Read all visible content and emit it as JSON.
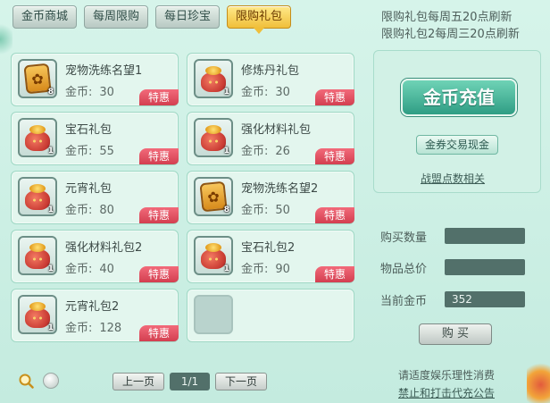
{
  "tabs": [
    {
      "label": "金币商城",
      "active": false
    },
    {
      "label": "每周限购",
      "active": false
    },
    {
      "label": "每日珍宝",
      "active": false
    },
    {
      "label": "限购礼包",
      "active": true
    }
  ],
  "items": [
    {
      "name": "宠物洗练名望1",
      "price_label": "金币:",
      "price": "30",
      "count": "8",
      "icon": "paw-card-icon",
      "badge": "特惠"
    },
    {
      "name": "修炼丹礼包",
      "price_label": "金币:",
      "price": "30",
      "count": "1",
      "icon": "gift-bag-icon",
      "badge": "特惠"
    },
    {
      "name": "宝石礼包",
      "price_label": "金币:",
      "price": "55",
      "count": "1",
      "icon": "gift-bag-icon",
      "badge": "特惠"
    },
    {
      "name": "强化材料礼包",
      "price_label": "金币:",
      "price": "26",
      "count": "1",
      "icon": "gift-bag-icon",
      "badge": "特惠"
    },
    {
      "name": "元宵礼包",
      "price_label": "金币:",
      "price": "80",
      "count": "1",
      "icon": "gift-bag-icon",
      "badge": "特惠"
    },
    {
      "name": "宠物洗练名望2",
      "price_label": "金币:",
      "price": "50",
      "count": "8",
      "icon": "paw-card-icon",
      "badge": "特惠"
    },
    {
      "name": "强化材料礼包2",
      "price_label": "金币:",
      "price": "40",
      "count": "1",
      "icon": "gift-bag-icon",
      "badge": "特惠"
    },
    {
      "name": "宝石礼包2",
      "price_label": "金币:",
      "price": "90",
      "count": "1",
      "icon": "gift-bag-icon",
      "badge": "特惠"
    },
    {
      "name": "元宵礼包2",
      "price_label": "金币:",
      "price": "128",
      "count": "1",
      "icon": "gift-bag-icon",
      "badge": "特惠"
    }
  ],
  "pager": {
    "prev": "上一页",
    "page": "1/1",
    "next": "下一页"
  },
  "notice": {
    "line1": "限购礼包每周五20点刷新",
    "line2": "限购礼包2每周三20点刷新"
  },
  "recharge": {
    "label": "金币充值",
    "coupon": "金券交易现金",
    "alliance": "战盟点数相关"
  },
  "form": {
    "qty_label": "购买数量",
    "qty_value": "",
    "total_label": "物品总价",
    "total_value": "",
    "coins_label": "当前金币",
    "coins_value": "352",
    "buy": "购 买"
  },
  "policy": {
    "line1": "请适度娱乐理性消费",
    "line2": "禁止和打击代充公告"
  }
}
